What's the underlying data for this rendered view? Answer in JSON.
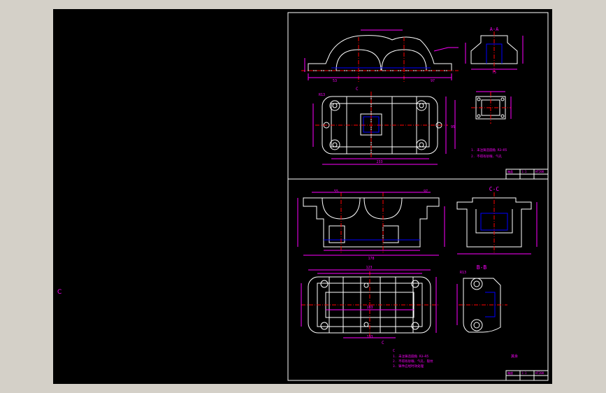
{
  "canvas": {
    "background": "#000000",
    "frame_color": "#ffffff",
    "outline_color": "#ffffff",
    "dim_color": "#ff00ff",
    "centerline_color": "#ff0000",
    "hidden_color": "#0000ff",
    "side_marker": "C"
  },
  "top_sheet": {
    "section_label": "A-A",
    "view_label": "C",
    "dims": {
      "length": "233",
      "height": "95",
      "radius": "R13",
      "width_a": "97",
      "width_b": "53",
      "half": "75"
    },
    "notes": [
      "1. 未注铸造圆角 R3~R5",
      "2. 不得有砂眼、气孔"
    ],
    "title_block": [
      "箱盖",
      "1:1",
      "HT200"
    ]
  },
  "bottom_sheet": {
    "section_label_cc": "C-C",
    "section_label_bb": "B-B",
    "view_label": "C",
    "dims": {
      "length": "178",
      "base": "133",
      "width": "123",
      "inner": "183",
      "radius": "R13",
      "height": "55",
      "right": "97"
    },
    "notes": [
      "1. 未注铸造圆角 R3~R5",
      "2. 不得有砂眼、气孔、裂纹",
      "3. 铸件应经时效处理"
    ],
    "roughness": "其余",
    "title_block": [
      "箱座",
      "1:1",
      "HT200"
    ]
  }
}
